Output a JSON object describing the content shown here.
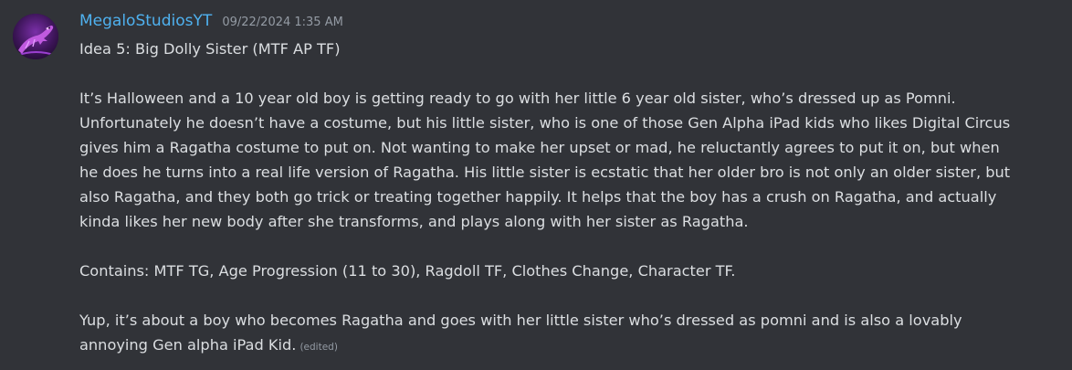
{
  "message": {
    "author": "MegaloStudiosYT",
    "timestamp": "09/22/2024 1:35 AM",
    "title_line": "Idea 5: Big Dolly Sister (MTF AP TF)",
    "body_lines": [
      "It’s Halloween and a 10 year old boy is getting ready to go with her little 6 year old sister, who’s dressed up as Pomni.",
      "Unfortunately he doesn’t have a costume, but his little sister, who is one of those Gen Alpha iPad kids who likes Digital Circus",
      "gives him a Ragatha costume to put on. Not wanting to make her upset or mad, he reluctantly agrees to put it on, but when",
      "he does he turns into a real life version of Ragatha. His little sister is ecstatic that her older bro is not only an older sister, but",
      "also Ragatha, and they both go trick or treating together happily. It helps that the boy has a crush on Ragatha, and actually",
      "kinda likes her new body after she transforms, and plays along with her sister as Ragatha."
    ],
    "contains_line": "Contains: MTF TG, Age Progression (11 to 30), Ragdoll TF, Clothes Change, Character TF.",
    "closing_lines": [
      "Yup, it’s about a boy who becomes Ragatha and goes with her little sister who’s dressed as pomni and is also a lovably",
      "annoying Gen alpha iPad Kid."
    ],
    "edited_label": "(edited)",
    "author_color": "#4fb1ef",
    "avatar_icon": "purple-raptor-avatar"
  }
}
